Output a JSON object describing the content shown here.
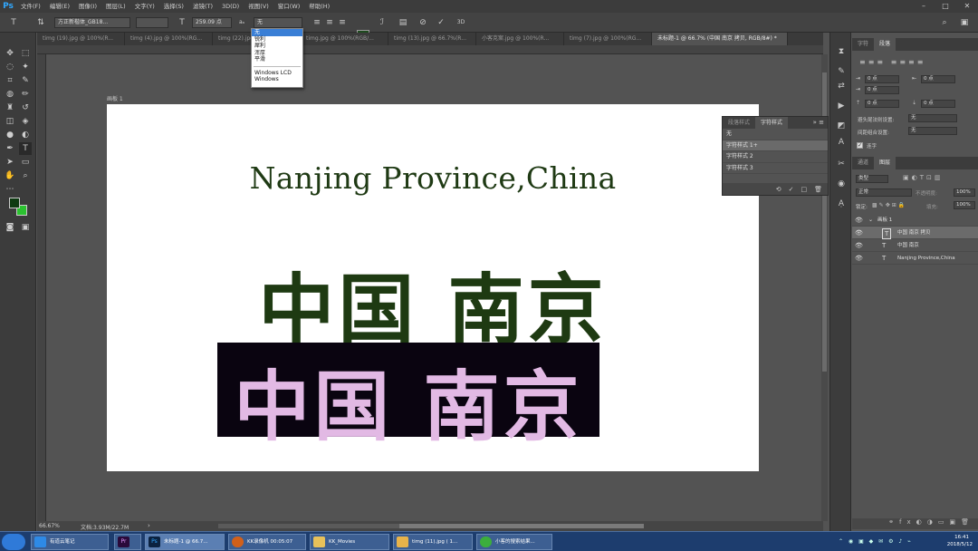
{
  "app": {
    "logo": "Ps"
  },
  "menu": [
    "文件(F)",
    "编辑(E)",
    "图像(I)",
    "图层(L)",
    "文字(Y)",
    "选择(S)",
    "滤镜(T)",
    "3D(D)",
    "视图(V)",
    "窗口(W)",
    "帮助(H)"
  ],
  "options": {
    "font_family": "方正新楷体_GB18...",
    "font_size": "259.09 点",
    "antialias_value": "无",
    "aa_label": "aₐ",
    "warp_label": "3D"
  },
  "dropdown": {
    "items": [
      "无",
      "锐利",
      "犀利",
      "浑厚",
      "平滑"
    ],
    "items2": [
      "Windows LCD",
      "Windows"
    ]
  },
  "tabs": [
    "timg (19).jpg @ 100%(R...",
    "timg (4).jpg @ 100%(RG...",
    "timg (22).jpg @ 100%(R...",
    "timg.jpg @ 100%(RGB/...",
    "timg (13).jpg @ 66.7%(R...",
    "小客克案.jpg @ 100%(R...",
    "timg (7).jpg @ 100%(RG...",
    "未标题-1 @ 66.7% (中国 南京 拷贝, RGB/8#) *"
  ],
  "canvas": {
    "artboard_label": "画板 1",
    "en_title": "Nanjing Province,China",
    "cn_title": "中国 南京",
    "cn_title_copy": "中国 南京",
    "green": "#1e3a12",
    "pink": "#e2b9e4"
  },
  "status": {
    "zoom": "66.67%",
    "doc": "文档:3.93M/22.7M"
  },
  "charstyles": {
    "tabs": [
      "段落样式",
      "字符样式"
    ],
    "items": [
      "无",
      "字符样式 1+",
      "字符样式 2",
      "字符样式 3"
    ],
    "foot": [
      "⟲",
      "✓",
      "□",
      "🗑"
    ]
  },
  "charpanel": {
    "tabs": [
      "字符",
      "段落"
    ],
    "fields": [
      "0 点",
      "0 点",
      "0 点",
      "0 点",
      "0 点"
    ],
    "label1": "避头尾法则设置:",
    "label1_val": "无",
    "label2": "间距组合设置:",
    "label2_val": "无",
    "hyphen": "连字"
  },
  "layers": {
    "tabs": [
      "通道",
      "图层"
    ],
    "kind": "类型",
    "blend": "正常",
    "opacity_label": "不透明度:",
    "opacity": "100%",
    "lock_label": "锁定:",
    "fill_label": "填充:",
    "fill": "100%",
    "rows": [
      {
        "name": "画板 1",
        "type": "group"
      },
      {
        "name": "中国 南京 拷贝",
        "type": "text"
      },
      {
        "name": "中国 南京",
        "type": "text"
      },
      {
        "name": "Nanjing Province,China",
        "type": "text"
      }
    ]
  },
  "taskbar": {
    "buttons": [
      "有道云笔记",
      "",
      "未标题-1 @ 66.7...",
      "KK录像机 00:05:07",
      "KK_Movies",
      "timg (11).jpg ( 1...",
      "小客的搜索结果..."
    ],
    "time": "16:41",
    "date": "2018/5/12"
  }
}
